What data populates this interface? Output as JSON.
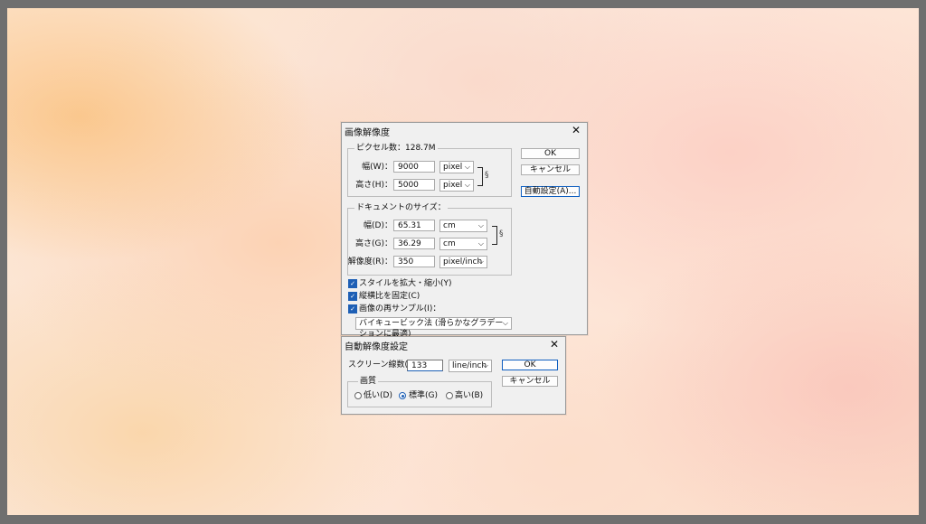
{
  "image_size_dialog": {
    "title": "画像解像度",
    "close": "✕",
    "pixel_group": {
      "label": "ピクセル数：128.7M",
      "width_label": "幅(W)：",
      "width_value": "9000",
      "width_unit": "pixel",
      "height_label": "高さ(H)：",
      "height_value": "5000",
      "height_unit": "pixel"
    },
    "document_group": {
      "label": "ドキュメントのサイズ：",
      "width_label": "幅(D)：",
      "width_value": "65.31",
      "width_unit": "cm",
      "height_label": "高さ(G)：",
      "height_value": "36.29",
      "height_unit": "cm",
      "resolution_label": "解像度(R)：",
      "resolution_value": "350",
      "resolution_unit": "pixel/inch"
    },
    "buttons": {
      "ok": "OK",
      "cancel": "キャンセル",
      "auto": "自動設定(A)..."
    },
    "checkboxes": {
      "scale_styles": "スタイルを拡大・縮小(Y)",
      "constrain": "縦横比を固定(C)",
      "resample": "画像の再サンプル(I)："
    },
    "resample_method": "バイキュービック法 (滑らかなグラデーションに最適)"
  },
  "auto_resolution_dialog": {
    "title": "自動解像度設定",
    "close": "✕",
    "screen_label": "スクリーン線数(S)：",
    "screen_value": "133",
    "screen_unit": "line/inch",
    "ok": "OK",
    "cancel": "キャンセル",
    "quality_group": {
      "label": "画質",
      "low": "低い(D)",
      "medium": "標準(G)",
      "high": "高い(B)",
      "selected": "medium"
    }
  }
}
